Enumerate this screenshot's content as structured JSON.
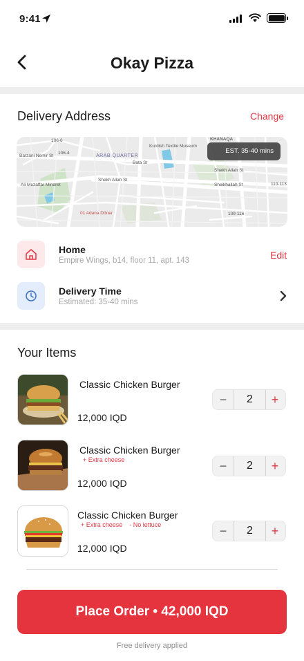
{
  "status_bar": {
    "time": "9:41"
  },
  "header": {
    "title": "Okay Pizza"
  },
  "delivery": {
    "section_title": "Delivery Address",
    "change_label": "Change",
    "map": {
      "eta_badge": "EST. 35-40 mins",
      "labels": [
        "KHANAQA",
        "Kurdish Textile Museum",
        "ARAB QUARTER",
        "Shekh Allah St",
        "Shekh Allah St",
        "Sheikhallah St",
        "Ali Muzaffar Minaret",
        "01 Adana Döner",
        "Bata St",
        "106-6",
        "106-4",
        "110-113",
        "109-116",
        "Barzani Nemir St"
      ]
    },
    "address": {
      "title": "Home",
      "detail": "Empire Wings, b14, floor 11, apt. 143",
      "edit_label": "Edit"
    },
    "time": {
      "title": "Delivery Time",
      "detail": "Estimated: 35-40 mins"
    }
  },
  "items_section": {
    "title": "Your Items",
    "items": [
      {
        "name": "Classic Chicken Burger",
        "modifiers": [],
        "price": "12,000 IQD",
        "quantity": "2"
      },
      {
        "name": "Classic Chicken Burger",
        "modifiers": [
          "+ Extra cheese"
        ],
        "price": "12,000 IQD",
        "quantity": "2"
      },
      {
        "name": "Classic Chicken Burger",
        "modifiers": [
          "+ Extra cheese",
          "- No lettuce"
        ],
        "price": "12,000 IQD",
        "quantity": "2"
      }
    ],
    "minus_symbol": "−",
    "plus_symbol": "+"
  },
  "cta": {
    "label": "Place Order • 42,000 IQD"
  },
  "footer": {
    "note": "Free delivery applied"
  },
  "colors": {
    "accent": "#e23744",
    "button": "#e6343f",
    "home_icon_bg": "#fde8ea",
    "clock_icon_bg": "#e3edfb",
    "clock_icon": "#3a6fc4"
  },
  "icons": [
    "location-arrow-icon",
    "signal-icon",
    "wifi-icon",
    "battery-icon",
    "back-chevron-icon",
    "home-icon",
    "clock-icon",
    "chevron-right-icon"
  ]
}
